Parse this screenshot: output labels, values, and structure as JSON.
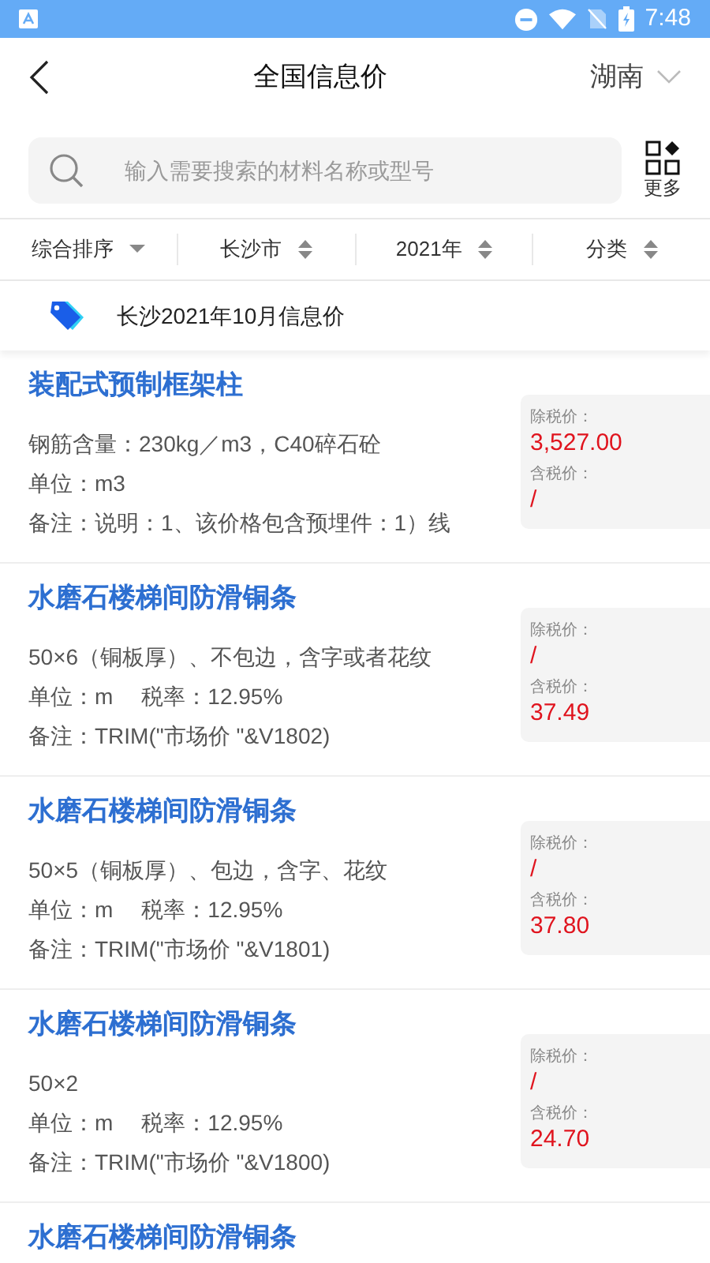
{
  "status_bar": {
    "time": "7:48"
  },
  "header": {
    "title": "全国信息价",
    "region": "湖南"
  },
  "search": {
    "placeholder": "输入需要搜索的材料名称或型号",
    "more_label": "更多"
  },
  "filters": [
    {
      "label": "综合排序",
      "kind": "dropdown"
    },
    {
      "label": "长沙市",
      "kind": "sort"
    },
    {
      "label": "2021年",
      "kind": "sort"
    },
    {
      "label": "分类",
      "kind": "sort"
    }
  ],
  "banner": {
    "text": "长沙2021年10月信息价"
  },
  "items": [
    {
      "title": "装配式预制框架柱",
      "spec": "钢筋含量：230kg／m3，C40碎石砼",
      "unit": "单位：m3",
      "note": "备注：说明：1、该价格包含预埋件：1）线",
      "pre_tax_label": "除税价：",
      "pre_tax": "3,527.00",
      "tax_incl_label": "含税价：",
      "tax_incl": "/"
    },
    {
      "title": "水磨石楼梯间防滑铜条",
      "spec": "50×6（铜板厚）、不包边，含字或者花纹",
      "unit": "单位：m",
      "tax_rate": "税率：12.95%",
      "note": "备注：TRIM(\"市场价 \"&V1802)",
      "pre_tax_label": "除税价：",
      "pre_tax": "/",
      "tax_incl_label": "含税价：",
      "tax_incl": "37.49"
    },
    {
      "title": "水磨石楼梯间防滑铜条",
      "spec": "50×5（铜板厚）、包边，含字、花纹",
      "unit": "单位：m",
      "tax_rate": "税率：12.95%",
      "note": "备注：TRIM(\"市场价 \"&V1801)",
      "pre_tax_label": "除税价：",
      "pre_tax": "/",
      "tax_incl_label": "含税价：",
      "tax_incl": "37.80"
    },
    {
      "title": "水磨石楼梯间防滑铜条",
      "spec": "50×2",
      "unit": "单位：m",
      "tax_rate": "税率：12.95%",
      "note": "备注：TRIM(\"市场价 \"&V1800)",
      "pre_tax_label": "除税价：",
      "pre_tax": "/",
      "tax_incl_label": "含税价：",
      "tax_incl": "24.70"
    },
    {
      "title": "水磨石楼梯间防滑铜条"
    }
  ]
}
